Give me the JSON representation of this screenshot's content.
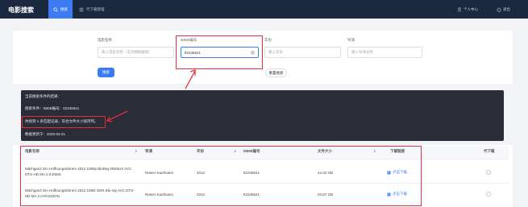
{
  "app": {
    "brand": "电影搜索"
  },
  "nav": {
    "tabs": [
      {
        "label": "搜索",
        "icon": "search-icon"
      },
      {
        "label": "代下载管理",
        "icon": "list-icon"
      }
    ],
    "user_label": "个人中心",
    "logout_label": "退出"
  },
  "search": {
    "fields": [
      {
        "label": "电影名称",
        "placeholder": "输入电影名称（支持模糊搜索）",
        "value": ""
      },
      {
        "label": "IMDB编号",
        "placeholder": "",
        "value": "tt2345641"
      },
      {
        "label": "年份",
        "placeholder": "输入年份",
        "value": ""
      },
      {
        "label": "导演",
        "placeholder": "输入导演名称",
        "value": ""
      }
    ],
    "search_button": "搜索",
    "reset_button": "重置搜索"
  },
  "result": {
    "lines": [
      "当前搜索条件的结果：",
      "搜索条件：IMDB编号：tt2345641",
      "共找到 1 条匹配记录，符合文件大小排序列。",
      "数据更新于：2025-03-21"
    ]
  },
  "table": {
    "columns": [
      "电影名称",
      "导演",
      "年份",
      "IMDB编号",
      "文件大小",
      "下载链接",
      "代下载"
    ],
    "rows": [
      {
        "title": "Mitchgard: Ein Hoffnungsklirrem 2012 1080p BluRay REMUX AVC DTS-HD MA 2.0-EMIS",
        "director": "Rainer Kaufmann",
        "year": "2012",
        "imdb": "tt2345641",
        "size": "14.34 GB",
        "link": "点击下载"
      },
      {
        "title": "Mitchgard: Ein Hoffnungsklirrem 2012 1080i GER Blu-ray AVC DTS-HD MA 2.0-PASSION",
        "director": "Rainer Kaufmann",
        "year": "2012",
        "imdb": "tt2345641",
        "size": "20.87 GB",
        "link": "点击下载"
      }
    ]
  },
  "colors": {
    "topbar": "#1b2940",
    "accent": "#3d7bf4",
    "highlight": "#e0303a",
    "result_bg": "#2a2c38"
  }
}
